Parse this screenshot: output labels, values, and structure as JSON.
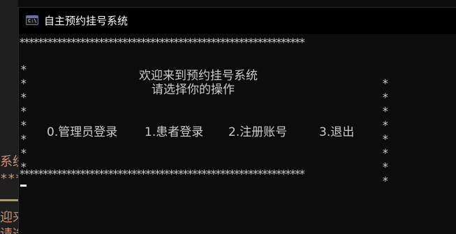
{
  "background_editor": {
    "line1": "系统",
    "line2": "****",
    "line3": "迎来",
    "line4": "请选"
  },
  "window": {
    "icon_label": "C:\\",
    "title": "自主预约挂号系统"
  },
  "console": {
    "border_row": "*************************************************************",
    "side_char": "*",
    "welcome": "欢迎来到预约挂号系统",
    "prompt": "请选择你的操作",
    "menu": [
      "0.管理员登录",
      "1.患者登录",
      "2.注册账号",
      "3.退出"
    ]
  }
}
